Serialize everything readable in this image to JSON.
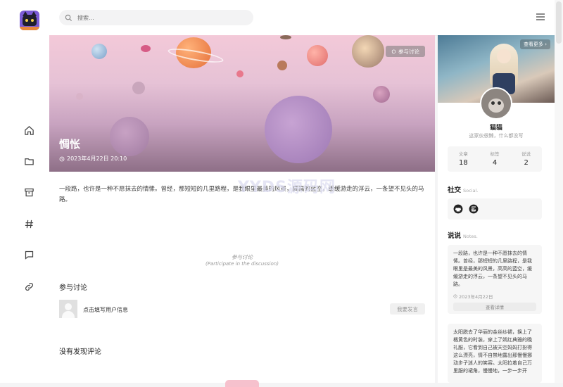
{
  "search": {
    "placeholder": "搜索..."
  },
  "nav": [
    "home-icon",
    "folder-icon",
    "archive-icon",
    "hash-icon",
    "chat-icon",
    "link-icon"
  ],
  "hero": {
    "title": "惆怅",
    "date": "2023年4月22日 20:10",
    "discuss_label": "参与讨论"
  },
  "article": {
    "text": "一段路，也许是一种不愿抹去的情愫。曾经，那短短的几里路程，是我眼里最美的风景，高高的蓝空，缓缓游走的浮云，一条望不见头的马路。"
  },
  "comments": {
    "divider_title": "参与讨论",
    "divider_sub": "(Participate in the discussion)",
    "section_title": "参与讨论",
    "fill_info": "点击填写用户信息",
    "post_label": "我要发言",
    "empty_title": "没有发现评论"
  },
  "profile": {
    "more_label": "查看更多",
    "name": "猫猫",
    "desc": "这家伙很懒，什么都没写",
    "stats": [
      {
        "label": "文章",
        "value": "18"
      },
      {
        "label": "标签",
        "value": "4"
      },
      {
        "label": "说说",
        "value": "2"
      }
    ]
  },
  "social": {
    "title": "社交",
    "sub": "Social.",
    "icons": [
      "github-icon",
      "gitee-icon"
    ]
  },
  "notes": {
    "title": "说说",
    "sub": "Notes.",
    "items": [
      {
        "text": "一段路，也许是一种不愿抹去的情愫。曾经，那短短的几里路程，是我眼里是最美的风景，高高的蓝空，缓缓游走的浮云，一条望不见头的马路。",
        "date": "2023年4月22日",
        "button": "查看详情"
      },
      {
        "text": "太阳脱去了华丽的金丝纱裙，换上了橘黄色的时装，穿上了嫣红典雅的晚礼服，它看到自己被天空妈妈打扮得这么漂亮，情不自禁地露出那慢慢挪动步子迷人的笑容。太阳拉着自己万里服的裙角，慢慢地，一步一步开"
      }
    ]
  },
  "watermark": "YYDS源码网"
}
